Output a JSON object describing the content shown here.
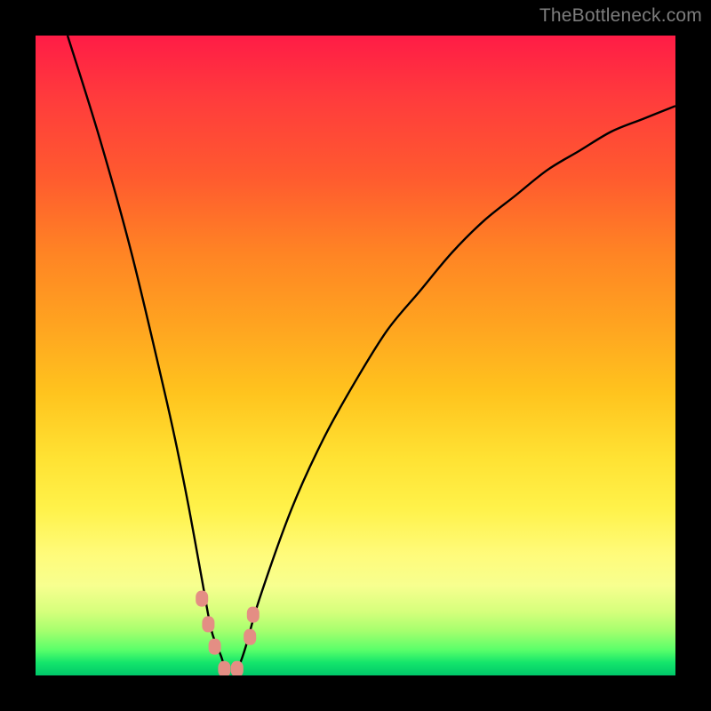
{
  "watermark": "TheBottleneck.com",
  "chart_data": {
    "type": "line",
    "title": "",
    "xlabel": "",
    "ylabel": "",
    "xlim": [
      0,
      100
    ],
    "ylim": [
      0,
      100
    ],
    "background_gradient_meaning": "top=red(bad) to bottom=green(good)",
    "series": [
      {
        "name": "bottleneck-curve",
        "x": [
          5,
          10,
          15,
          20,
          22,
          24,
          26,
          27.5,
          29,
          30,
          31,
          32,
          33,
          35,
          40,
          45,
          50,
          55,
          60,
          65,
          70,
          75,
          80,
          85,
          90,
          95,
          100
        ],
        "y": [
          100,
          84,
          66,
          45,
          36,
          26,
          15,
          7,
          3,
          0,
          0,
          2,
          5,
          12,
          26,
          37,
          46,
          54,
          60,
          66,
          71,
          75,
          79,
          82,
          85,
          87,
          89
        ]
      }
    ],
    "markers": [
      {
        "name": "marker",
        "x": 26.0,
        "y": 12.0
      },
      {
        "name": "marker",
        "x": 27.0,
        "y": 8.0
      },
      {
        "name": "marker",
        "x": 28.0,
        "y": 4.5
      },
      {
        "name": "marker",
        "x": 29.5,
        "y": 1.0
      },
      {
        "name": "marker",
        "x": 31.5,
        "y": 1.0
      },
      {
        "name": "marker",
        "x": 33.5,
        "y": 6.0
      },
      {
        "name": "marker",
        "x": 34.0,
        "y": 9.5
      }
    ],
    "marker_color": "#e48e84",
    "curve_color": "#000000"
  }
}
